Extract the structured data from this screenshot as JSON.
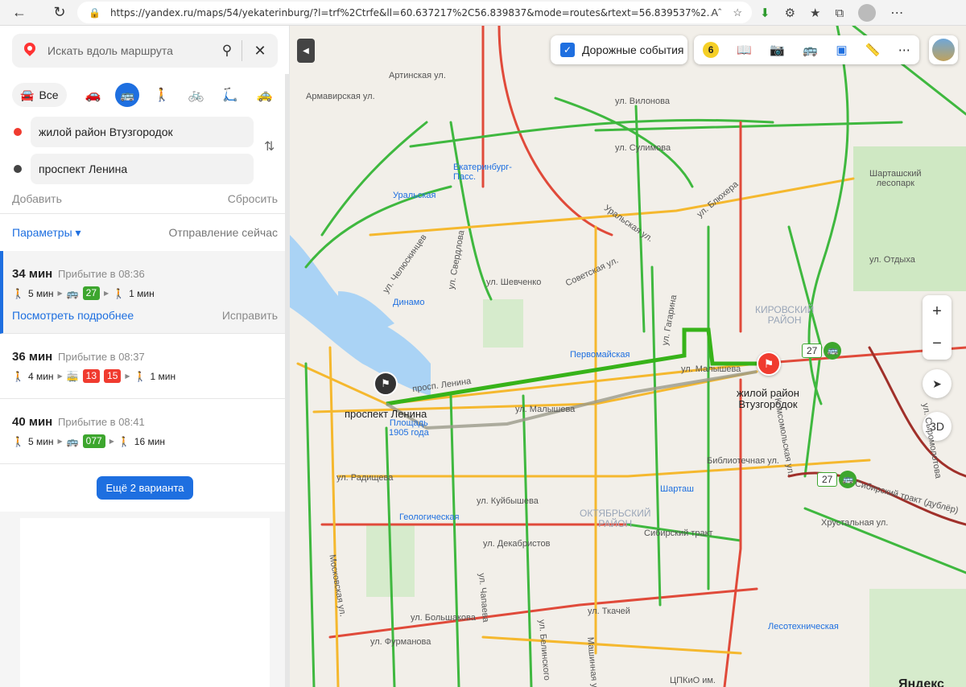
{
  "browser": {
    "url": "https://yandex.ru/maps/54/yekaterinburg/?l=trf%2Ctrfe&ll=60.637217%2C56.839837&mode=routes&rtext=56.839537%2...",
    "reader_icon": "Aˆ"
  },
  "search": {
    "placeholder": "Искать вдоль маршрута"
  },
  "modes": {
    "all_label": "Все"
  },
  "route_points": {
    "from": "жилой район Втузгородок",
    "to": "проспект Ленина",
    "add": "Добавить",
    "reset": "Сбросить"
  },
  "params": {
    "label": "Параметры ▾",
    "departure": "Отправление сейчас"
  },
  "routes": [
    {
      "time": "34 мин",
      "arrival": "Прибытие в 08:36",
      "walk1": "5 мин",
      "buses": [
        "27"
      ],
      "walk2": "1 мин",
      "details": "Посмотреть подробнее",
      "fix": "Исправить"
    },
    {
      "time": "36 мин",
      "arrival": "Прибытие в 08:37",
      "walk1": "4 мин",
      "buses": [
        "13",
        "15"
      ],
      "walk2": "1 мин"
    },
    {
      "time": "40 мин",
      "arrival": "Прибытие в 08:41",
      "walk1": "5 мин",
      "buses": [
        "077"
      ],
      "walk2": "16 мин"
    }
  ],
  "more_variants": "Ещё 2 варианта",
  "map": {
    "traffic_events": "Дорожные события",
    "traffic_level": "6",
    "zoom_in": "+",
    "zoom_out": "−",
    "view_3d": "3D",
    "bus_27": "27",
    "start_label": "проспект Ленина",
    "end_label_1": "жилой район",
    "end_label_2": "Втузгородок",
    "labels": {
      "artinskaya": "Артинская ул.",
      "armavirskaya": "Армавирская ул.",
      "vilonova": "ул. Вилонова",
      "sulimova": "ул. Сулимова",
      "ekb_pass_1": "Екатеринбург-",
      "ekb_pass_2": "Пасс.",
      "uralskaya_m": "Уральская",
      "shartash_park_1": "Шарташский",
      "shartash_park_2": "лесопарк",
      "chelyuskintsev": "ул. Челюскинцев",
      "sverdlova": "ул. Свердлова",
      "sovetskaya": "Советская ул.",
      "bluhera": "ул. Блюхера",
      "uralskaya": "Уральская ул.",
      "otdyha": "ул. Отдыха",
      "shevchenko": "ул. Шевченко",
      "dinamo": "Динамо",
      "kirovsky_1": "КИРОВСКИЙ",
      "kirovsky_2": "РАЙОН",
      "gagarina": "ул. Гагарина",
      "pervomayskaya": "Первомайская",
      "pervomayskaya_st": "Первомайская",
      "malysheva": "ул. Малышева",
      "malysheva2": "ул. Малышева",
      "lenina": "просп. Ленина",
      "lenina2": "просп. Ленина",
      "ploshad_1": "Площадь",
      "ploshad_2": "1905 года",
      "komsomolskaya": "Комсомольская ул.",
      "bibliotechnaya": "Библиотечная ул.",
      "radishcheva": "ул. Радищева",
      "kuybysheva": "ул. Куйбышева",
      "shartash": "Шарташ",
      "geologicheskaya": "Геологическая",
      "oktyabrsky_1": "ОКТЯБРЬСКИЙ",
      "oktyabrsky_2": "РАЙОН",
      "sibirsky": "Сибирский тракт",
      "sibirsky_dubler": "Сибирский тракт (дублёр)",
      "hrustalnaya": "Хрустальная ул.",
      "dekabristov": "ул. Декабристов",
      "tkachey": "ул. Ткачей",
      "bolshakova": "ул. Большакова",
      "furmanova": "ул. Фурманова",
      "lesotehnicheskaya": "Лесотехническая",
      "moskovskaya": "Московская ул.",
      "chapaeva": "ул. Чапаева",
      "belinskogo": "ул. Белинского",
      "mashinnaya": "Машинная ул.",
      "sverdlovykh": "ул. Сыромолотова",
      "tspkio": "ЦПКиО им.",
      "yandex": "Яндекс"
    }
  },
  "colors": {
    "accent": "#1e6fe0",
    "route_green": "#3da62e",
    "red_pin": "#f03b2f"
  }
}
